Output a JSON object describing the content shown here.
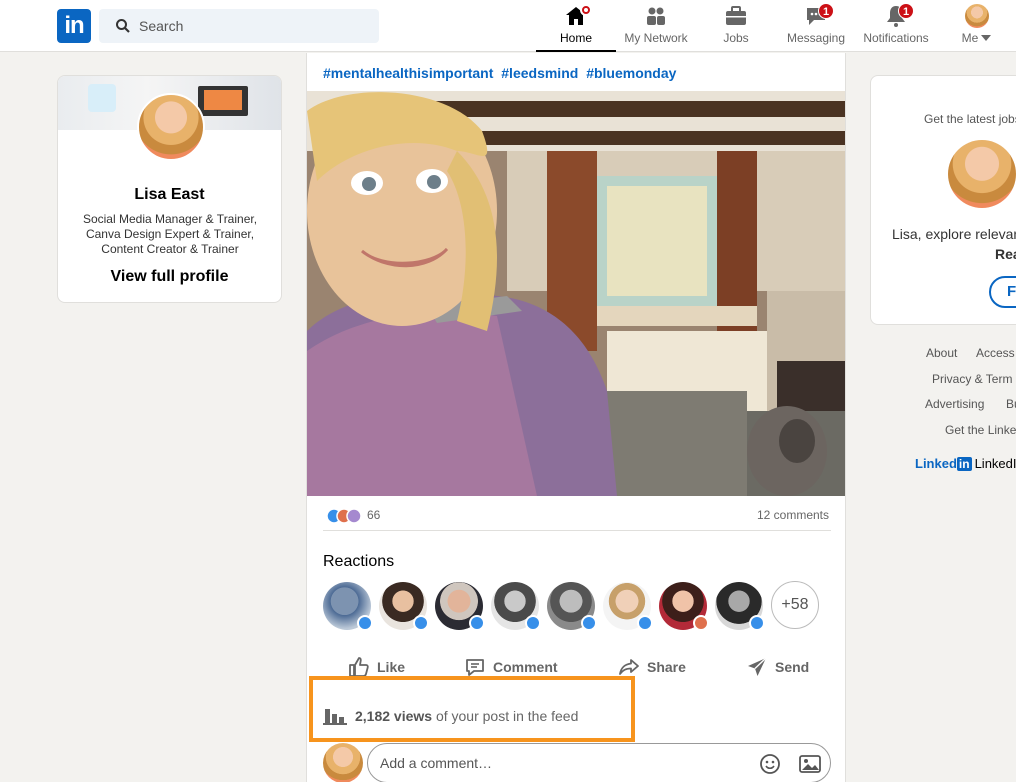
{
  "nav": {
    "logo": "in",
    "search_placeholder": "Search",
    "items": [
      {
        "label": "Home",
        "icon": "home-icon",
        "badge": ""
      },
      {
        "label": "My Network",
        "icon": "network-icon",
        "badge": ""
      },
      {
        "label": "Jobs",
        "icon": "briefcase-icon",
        "badge": ""
      },
      {
        "label": "Messaging",
        "icon": "messaging-icon",
        "badge": "1"
      },
      {
        "label": "Notifications",
        "icon": "bell-icon",
        "badge": "1"
      },
      {
        "label": "Me",
        "icon": "avatar",
        "badge": ""
      }
    ]
  },
  "profile": {
    "name": "Lisa East",
    "headline": "Social Media Manager & Trainer, Canva Design Expert & Trainer, Content Creator & Trainer",
    "view_link": "View full profile"
  },
  "post": {
    "hashtags": [
      "#mentalhealthisimportant",
      "#leedsmind",
      "#bluemonday"
    ],
    "reaction_count": "66",
    "comment_count": "12 comments",
    "reactions_title": "Reactions",
    "more_reactors": "+58",
    "actions": {
      "like": "Like",
      "comment": "Comment",
      "share": "Share",
      "send": "Send"
    },
    "views_count": "2,182 views",
    "views_suffix": "of your post in the feed",
    "comment_placeholder": "Add a comment…"
  },
  "sidebar": {
    "ad_line1": "Get the latest jobs",
    "ad_line2": "Lisa, explore relevant",
    "ad_line3": "Rea",
    "ad_button": "Fo",
    "footer": [
      "About",
      "Access",
      "Privacy & Term",
      "Advertising",
      "Bu",
      "Get the Linke"
    ],
    "brand_word": "Linked",
    "brand_in": "in",
    "brand_corp": "LinkedI"
  },
  "colors": {
    "brand": "#0a66c2",
    "highlight": "#f7941d",
    "badge": "#cc1016"
  }
}
